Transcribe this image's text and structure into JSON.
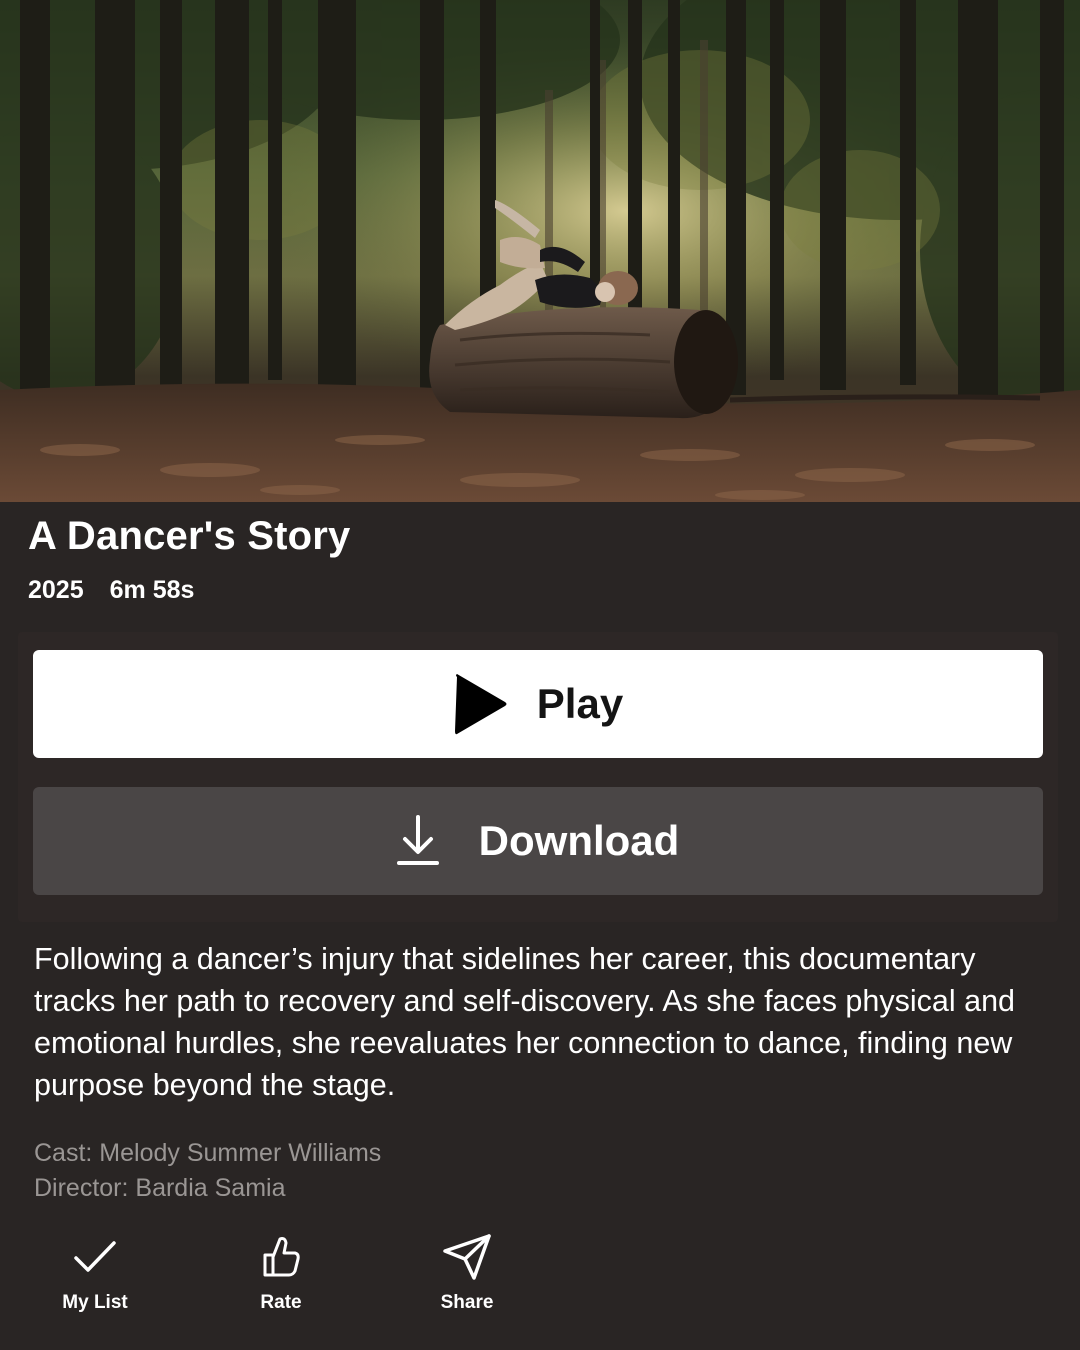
{
  "hero": {
    "image_icon": "forest-dancer-scene"
  },
  "title": "A Dancer's Story",
  "meta": {
    "year": "2025",
    "duration": "6m 58s"
  },
  "buttons": {
    "play_label": "Play",
    "play_icon": "play-icon",
    "download_label": "Download",
    "download_icon": "download-icon"
  },
  "description": "Following a dancer’s injury that sidelines her career, this documentary tracks her path to recovery and self-discovery. As she faces physical and emotional hurdles, she reevaluates her connection to dance, finding new purpose beyond the stage.",
  "credits": {
    "cast": "Cast: Melody Summer Williams",
    "director": "Director: Bardia Samia"
  },
  "actions": [
    {
      "label": "My List",
      "icon": "check-icon"
    },
    {
      "label": "Rate",
      "icon": "thumbs-up-icon"
    },
    {
      "label": "Share",
      "icon": "send-icon"
    }
  ],
  "colors": {
    "background": "#292524",
    "play_button": "#ffffff",
    "download_button": "#4a4646",
    "text_primary": "#ffffff",
    "text_secondary": "#9a9694"
  }
}
